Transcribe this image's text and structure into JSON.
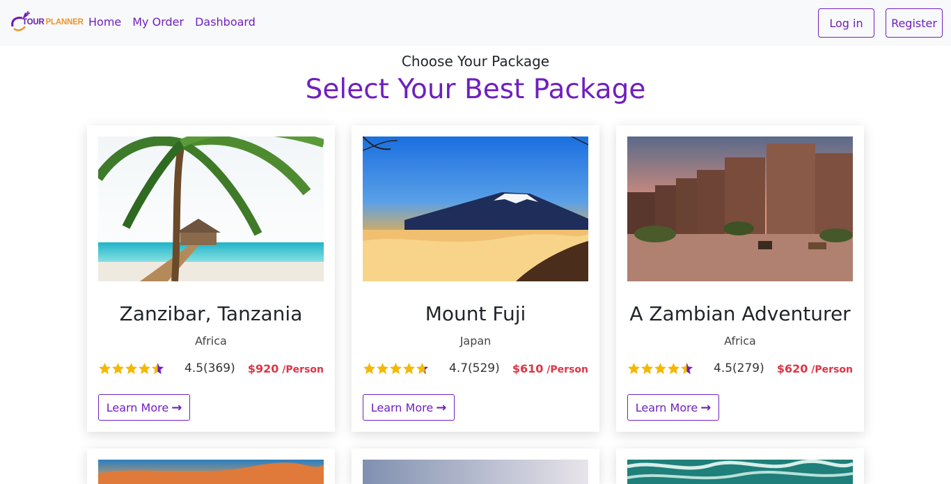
{
  "brand": {
    "word1": "TOUR",
    "word2": "PLANNER"
  },
  "nav": {
    "links": [
      "Home",
      "My Order",
      "Dashboard"
    ],
    "login": "Log in",
    "register": "Register"
  },
  "header": {
    "subtitle": "Choose Your Package",
    "title": "Select Your Best Package"
  },
  "packages": [
    {
      "name": "Zanzibar, Tanzania",
      "region": "Africa",
      "rating_value": 4.5,
      "rating_text": "4.5(369)",
      "price": "$920",
      "per": " /Person",
      "cta": "Learn More",
      "image": "beach-pier-palm"
    },
    {
      "name": "Mount Fuji",
      "region": "Japan",
      "rating_value": 4.7,
      "rating_text": "4.7(529)",
      "price": "$610",
      "per": " /Person",
      "cta": "Learn More",
      "image": "mountain-fuji"
    },
    {
      "name": "A Zambian Adventurer",
      "region": "Africa",
      "rating_value": 4.5,
      "rating_text": "4.5(279)",
      "price": "$620",
      "per": " /Person",
      "cta": "Learn More",
      "image": "desert-fort-camels"
    },
    {
      "image": "sunset-sky"
    },
    {
      "image": "grey-gradient"
    },
    {
      "image": "ocean-waves"
    }
  ],
  "colors": {
    "accent": "#6f1fbf",
    "price": "#dc3545",
    "star": "#f5b800",
    "star_partial": "#6f1fbf"
  }
}
